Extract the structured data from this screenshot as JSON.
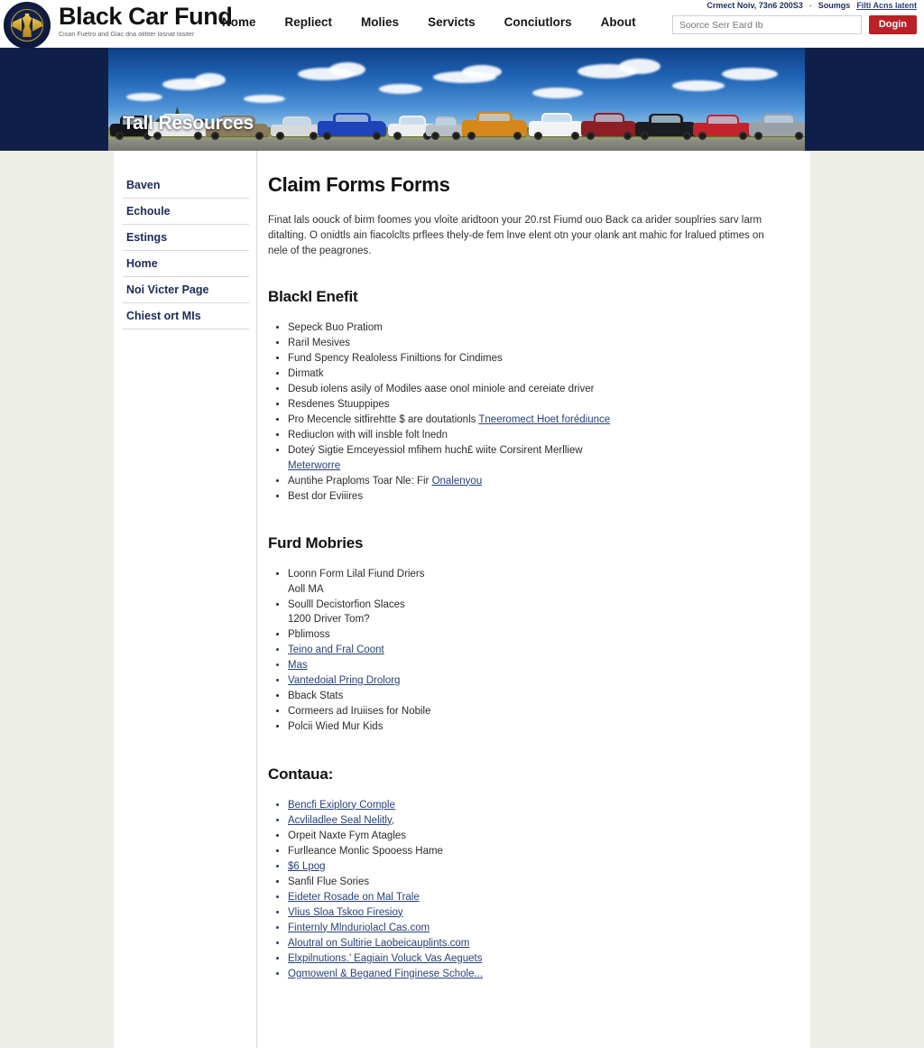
{
  "brand": {
    "name": "Black Car Fund",
    "tagline": "Cisan Fuetro and Glac dna olifiter losnat lositer",
    "seal_name": "black-car-fund-seal"
  },
  "nav": {
    "items": [
      {
        "label": "Nome"
      },
      {
        "label": "Repliect"
      },
      {
        "label": "Molies"
      },
      {
        "label": "Servicts"
      },
      {
        "label": "Conciutlors"
      },
      {
        "label": "About"
      }
    ]
  },
  "utility": {
    "contact": "Crmect Noiv, 73n6 200S3",
    "separator": "-",
    "services": "Soumgs",
    "link": "Filti Acns latent"
  },
  "search": {
    "placeholder": "Soorce Serr Eard Ib",
    "value": "",
    "login_label": "Dogin"
  },
  "banner": {
    "title": "Tall Resources"
  },
  "sidebar": {
    "items": [
      {
        "label": "Baven"
      },
      {
        "label": "Echoule"
      },
      {
        "label": "Estings"
      },
      {
        "label": "Home"
      },
      {
        "label": "Noi Victer Page"
      },
      {
        "label": "Chiest ort MIs"
      }
    ]
  },
  "main": {
    "title": "Claim Forms Forms",
    "intro": "Finat lals oouck of birm foomes you vloite aridtoon your 20.rst Fiumd ouo Back ca arider souplries sarv larm ditalting. O onidtls ain fiacolclts prflees thely-de fem lnve elent otn your olank ant mahic for lralued ptimes on nele of the peagrones.",
    "sections": [
      {
        "heading": "Blackl Enefit",
        "items": [
          {
            "text": "Sepeck Buo Pratiom",
            "link": false
          },
          {
            "text": "Raril Mesives",
            "link": false
          },
          {
            "text": "Fund Spency Realoless Finiltions for Cindimes",
            "link": false
          },
          {
            "text": "Dirmatk",
            "link": false
          },
          {
            "text": "Desub iolens asily of Modiles aase onol miniole and cereiate driver",
            "link": false
          },
          {
            "text": "Resdenes Stuuppipes",
            "link": false
          },
          {
            "text": "Pro Mecencle sitfirehtte $ are doutationls",
            "link": false,
            "trailing_link": "Tneeromect Hoet forédiunce"
          },
          {
            "text": "Rediuclon with will insble folt lnedn",
            "link": false
          },
          {
            "text": "Doteý Sigtie Emceyessiol mfihem huch£ wiite Corsirent Merlliew",
            "link": false,
            "sub_link": "Meterworre"
          },
          {
            "text": "Auntihe Praploms Toar Nle: Fir",
            "link": false,
            "trailing_link": "Onalenyou"
          },
          {
            "text": "Best dor Eviiires",
            "link": false
          }
        ]
      },
      {
        "heading": "Furd Mobries",
        "items": [
          {
            "text": "Loonn Form Lilal Fiund Driers",
            "link": false,
            "sub": "Aoll MA"
          },
          {
            "text": "Soulll Decistorfion Slaces",
            "link": false,
            "sub": "1200 Driver Tom?"
          },
          {
            "text": "Pblimoss",
            "link": false
          },
          {
            "text": "Teino and Fral Coont",
            "link": true
          },
          {
            "text": "Mas",
            "link": true
          },
          {
            "text": "Vantedoial Pring Drolorg",
            "link": true
          },
          {
            "text": "Bback Stats",
            "link": false
          },
          {
            "text": "Cormeers ad Iruiises for Nobile",
            "link": false
          },
          {
            "text": "Polcii Wied Mur Kids",
            "link": false
          }
        ]
      },
      {
        "heading": "Contaua:",
        "items": [
          {
            "text": "Bencfi Exiplory Comple",
            "link": true
          },
          {
            "text": "Acvliladlee Seal Nelitly,",
            "link": true
          },
          {
            "text": "Orpeit Naxte Fym Atagles",
            "link": false
          },
          {
            "text": "Furlleance Monlic Spooess Hame",
            "link": false
          },
          {
            "text": "$6 Lpog",
            "link": true
          },
          {
            "text": "Sanfil Flue Sories",
            "link": false
          },
          {
            "text": "Eideter Rosade on Mal Trale",
            "link": true
          },
          {
            "text": "Vlius Sloa Tskoo Firesioy",
            "link": true
          },
          {
            "text": "Finternly Mlnduriolacl Cas.com",
            "link": true
          },
          {
            "text": "Aloutral on Sultirie Laobeicauplints.com",
            "link": true
          },
          {
            "text": "Elxpilnutions.’ Eagiain Voluck Vas Aeguets",
            "link": true
          },
          {
            "text": "Ogmowenl & Beganed Finginese Schole...",
            "link": true
          }
        ]
      }
    ]
  },
  "colors": {
    "brand_navy": "#1b2a5c",
    "accent_red": "#bb2026",
    "link_blue": "#27417e",
    "page_bg": "#ecede6"
  }
}
